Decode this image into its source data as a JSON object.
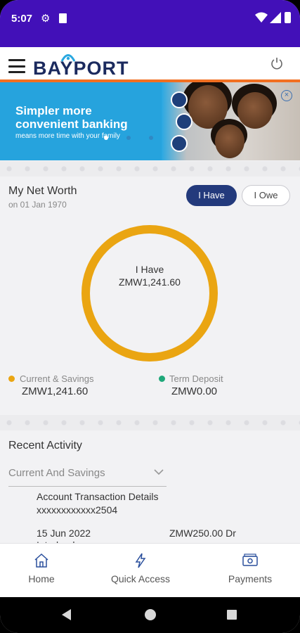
{
  "status_bar": {
    "time": "5:07",
    "icons": [
      "gear-icon",
      "sim-icon",
      "wifi-icon",
      "signal-icon",
      "battery-icon"
    ]
  },
  "app_bar": {
    "logo_text": "BAYPORT",
    "icons": [
      "menu-icon",
      "power-icon"
    ]
  },
  "banner": {
    "headline": "Simpler more convenient banking",
    "subtext": "means more time with your family"
  },
  "net_worth": {
    "title": "My Net Worth",
    "date": "on 01 Jan 1970",
    "tab_have": "I Have",
    "tab_owe": "I Owe",
    "center_label": "I Have",
    "center_value": "ZMW1,241.60",
    "legend": [
      {
        "name": "Current & Savings",
        "value": "ZMW1,241.60",
        "color": "#eaa512"
      },
      {
        "name": "Term Deposit",
        "value": "ZMW0.00",
        "color": "#1fa87a"
      }
    ]
  },
  "recent_activity": {
    "title": "Recent Activity",
    "selected_account": "Current And Savings",
    "transaction": {
      "title": "Account Transaction Details",
      "account": "xxxxxxxxxxxx2504",
      "date": "15 Jun 2022",
      "amount": "ZMW250.00 Dr",
      "partial_line": "Interbank"
    }
  },
  "bottom_nav": {
    "items": [
      {
        "label": "Home",
        "icon": "home-icon"
      },
      {
        "label": "Quick Access",
        "icon": "lightning-icon"
      },
      {
        "label": "Payments",
        "icon": "payments-icon"
      }
    ]
  },
  "colors": {
    "status_bar": "#4210b8",
    "brand_navy": "#1b2a5e",
    "accent_orange": "#f26f21",
    "banner_blue": "#26a3dd",
    "donut": "#eaa512",
    "nav_icon": "#2a4f9c"
  }
}
